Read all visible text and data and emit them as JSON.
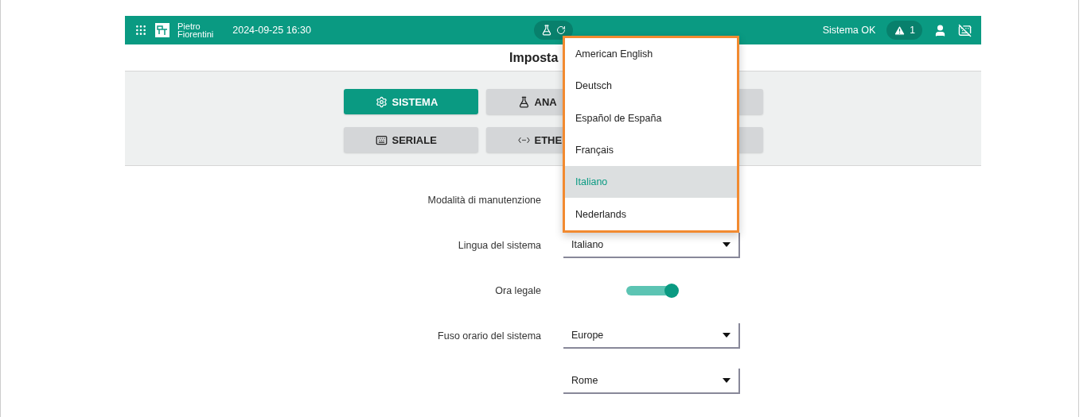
{
  "top_bar": {
    "brand": [
      "Pietro",
      "Fiorentini"
    ],
    "datetime": "2024-09-25 16:30",
    "status": "Sistema OK",
    "alerts": "1"
  },
  "title": "Imposta",
  "tabs": [
    {
      "label": "SISTEMA",
      "kind": "system",
      "selected": true
    },
    {
      "label": "ANA",
      "kind": "analysis",
      "selected": false
    },
    {
      "kind": "blank",
      "selected": false
    },
    {
      "label": "SERIALE",
      "kind": "serial",
      "selected": false
    },
    {
      "label": "ETHE",
      "kind": "ethernet",
      "selected": false
    },
    {
      "kind": "blank",
      "selected": false
    }
  ],
  "form": [
    {
      "kind": "hidden",
      "label": "Modalità di manutenzione"
    },
    {
      "kind": "select",
      "label": "Lingua del sistema",
      "value": "Italiano"
    },
    {
      "kind": "toggle",
      "label": "Ora legale",
      "on": true
    },
    {
      "kind": "select",
      "label": "Fuso orario del sistema",
      "value": "Europe"
    },
    {
      "kind": "select",
      "value": "Rome"
    }
  ],
  "language_menu": [
    {
      "label": "American English",
      "selected": false
    },
    {
      "label": "Deutsch",
      "selected": false
    },
    {
      "label": "Español de España",
      "selected": false
    },
    {
      "label": "Français",
      "selected": false
    },
    {
      "label": "Italiano",
      "selected": true
    },
    {
      "label": "Nederlands",
      "selected": false
    }
  ]
}
